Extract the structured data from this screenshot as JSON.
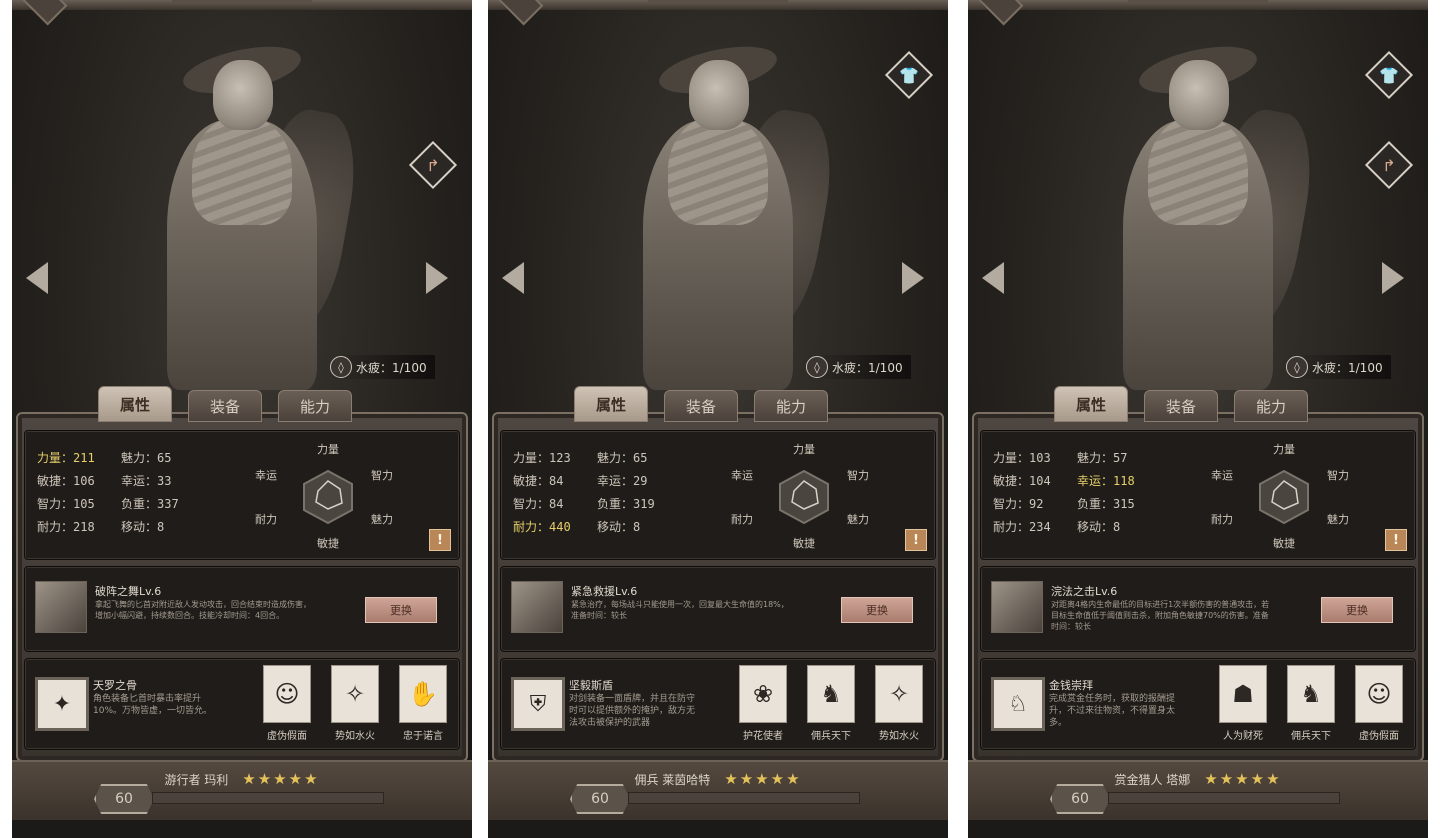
{
  "panels": [
    {
      "fatigue_label": "水疲：1/100",
      "tabs": [
        "属性",
        "装备",
        "能力"
      ],
      "stats": [
        {
          "label": "力量：211",
          "hl": true
        },
        {
          "label": "魅力：65",
          "hl": false
        },
        {
          "label": "敏捷：106",
          "hl": false
        },
        {
          "label": "幸运：33",
          "hl": false
        },
        {
          "label": "智力：105",
          "hl": false
        },
        {
          "label": "负重：337",
          "hl": false
        },
        {
          "label": "耐力：218",
          "hl": false
        },
        {
          "label": "移动：8",
          "hl": false
        }
      ],
      "radar": {
        "top": "力量",
        "tl": "幸运",
        "tr": "智力",
        "bl": "耐力",
        "br": "魅力",
        "bottom": "敏捷"
      },
      "skill": {
        "name": "破阵之舞Lv.6",
        "desc": "拿起飞舞的匕首对附近敌人发动攻击，回合结束时造成伤害，增加小幅闪避，持续数回合。技能冷却时间：4回合。",
        "button": "更换"
      },
      "trait": {
        "name": "天罗之骨",
        "desc": "角色装备匕首时暴击率提升10%。万物皆虚，一切皆允。",
        "icon": "✦"
      },
      "subtraits": [
        {
          "name": "虚伪假面",
          "icon": "☺"
        },
        {
          "name": "势如水火",
          "icon": "✧"
        },
        {
          "name": "忠于诺言",
          "icon": "✋"
        }
      ],
      "character": {
        "name": "游行者 玛利",
        "stars": "★★★★★",
        "level": "60"
      },
      "icons": {
        "side": [
          "share-icon"
        ]
      }
    },
    {
      "fatigue_label": "水疲：1/100",
      "tabs": [
        "属性",
        "装备",
        "能力"
      ],
      "stats": [
        {
          "label": "力量：123",
          "hl": false
        },
        {
          "label": "魅力：65",
          "hl": false
        },
        {
          "label": "敏捷：84",
          "hl": false
        },
        {
          "label": "幸运：29",
          "hl": false
        },
        {
          "label": "智力：84",
          "hl": false
        },
        {
          "label": "负重：319",
          "hl": false
        },
        {
          "label": "耐力：440",
          "hl": true
        },
        {
          "label": "移动：8",
          "hl": false
        }
      ],
      "radar": {
        "top": "力量",
        "tl": "幸运",
        "tr": "智力",
        "bl": "耐力",
        "br": "魅力",
        "bottom": "敏捷"
      },
      "skill": {
        "name": "紧急救援Lv.6",
        "desc": "紧急治疗，每场战斗只能使用一次，回复最大生命值的18%，准备时间：较长",
        "button": "更换"
      },
      "trait": {
        "name": "坚毅斯盾",
        "desc": "对剑装备一面盾牌，并且在防守时可以提供额外的掩护，敌方无法攻击被保护的武器",
        "icon": "⛨"
      },
      "subtraits": [
        {
          "name": "护花使者",
          "icon": "❀"
        },
        {
          "name": "佣兵天下",
          "icon": "♞"
        },
        {
          "name": "势如水火",
          "icon": "✧"
        }
      ],
      "character": {
        "name": "佣兵 莱茵哈特",
        "stars": "★★★★★",
        "level": "60"
      },
      "icons": {
        "side": [
          "shirt-icon"
        ]
      }
    },
    {
      "fatigue_label": "水疲：1/100",
      "tabs": [
        "属性",
        "装备",
        "能力"
      ],
      "stats": [
        {
          "label": "力量：103",
          "hl": false
        },
        {
          "label": "魅力：57",
          "hl": false
        },
        {
          "label": "敏捷：104",
          "hl": false
        },
        {
          "label": "幸运：118",
          "hl": true
        },
        {
          "label": "智力：92",
          "hl": false
        },
        {
          "label": "负重：315",
          "hl": false
        },
        {
          "label": "耐力：234",
          "hl": false
        },
        {
          "label": "移动：8",
          "hl": false
        }
      ],
      "radar": {
        "top": "力量",
        "tl": "幸运",
        "tr": "智力",
        "bl": "耐力",
        "br": "魅力",
        "bottom": "敏捷"
      },
      "skill": {
        "name": "浣法之击Lv.6",
        "desc": "对距离4格内生命最低的目标进行1次半额伤害的普通攻击，若目标生命值低于阈值则击杀，附加角色敏捷70%的伤害。准备时间：较长",
        "button": "更换"
      },
      "trait": {
        "name": "金钱崇拜",
        "desc": "完成赏金任务时，获取的报酬提升，不过来往物资，不得置身太多。",
        "icon": "♘"
      },
      "subtraits": [
        {
          "name": "人为财死",
          "icon": "☗"
        },
        {
          "name": "佣兵天下",
          "icon": "♞"
        },
        {
          "name": "虚伪假面",
          "icon": "☺"
        }
      ],
      "character": {
        "name": "赏金猎人 塔娜",
        "stars": "★★★★★",
        "level": "60"
      },
      "icons": {
        "side": [
          "shirt-icon",
          "share-icon"
        ]
      }
    }
  ]
}
